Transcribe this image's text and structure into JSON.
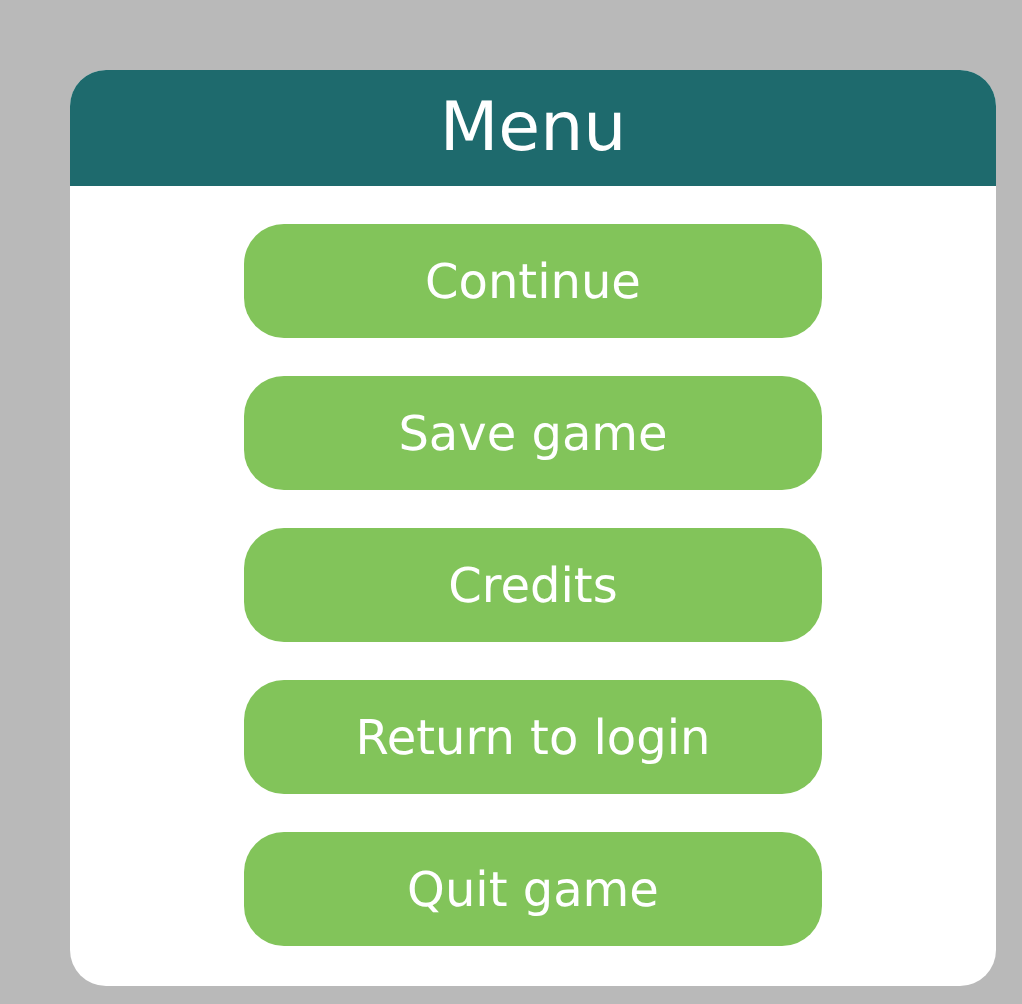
{
  "menu": {
    "title": "Menu",
    "buttons": [
      {
        "label": "Continue"
      },
      {
        "label": "Save game"
      },
      {
        "label": "Credits"
      },
      {
        "label": "Return to login"
      },
      {
        "label": "Quit game"
      }
    ]
  }
}
